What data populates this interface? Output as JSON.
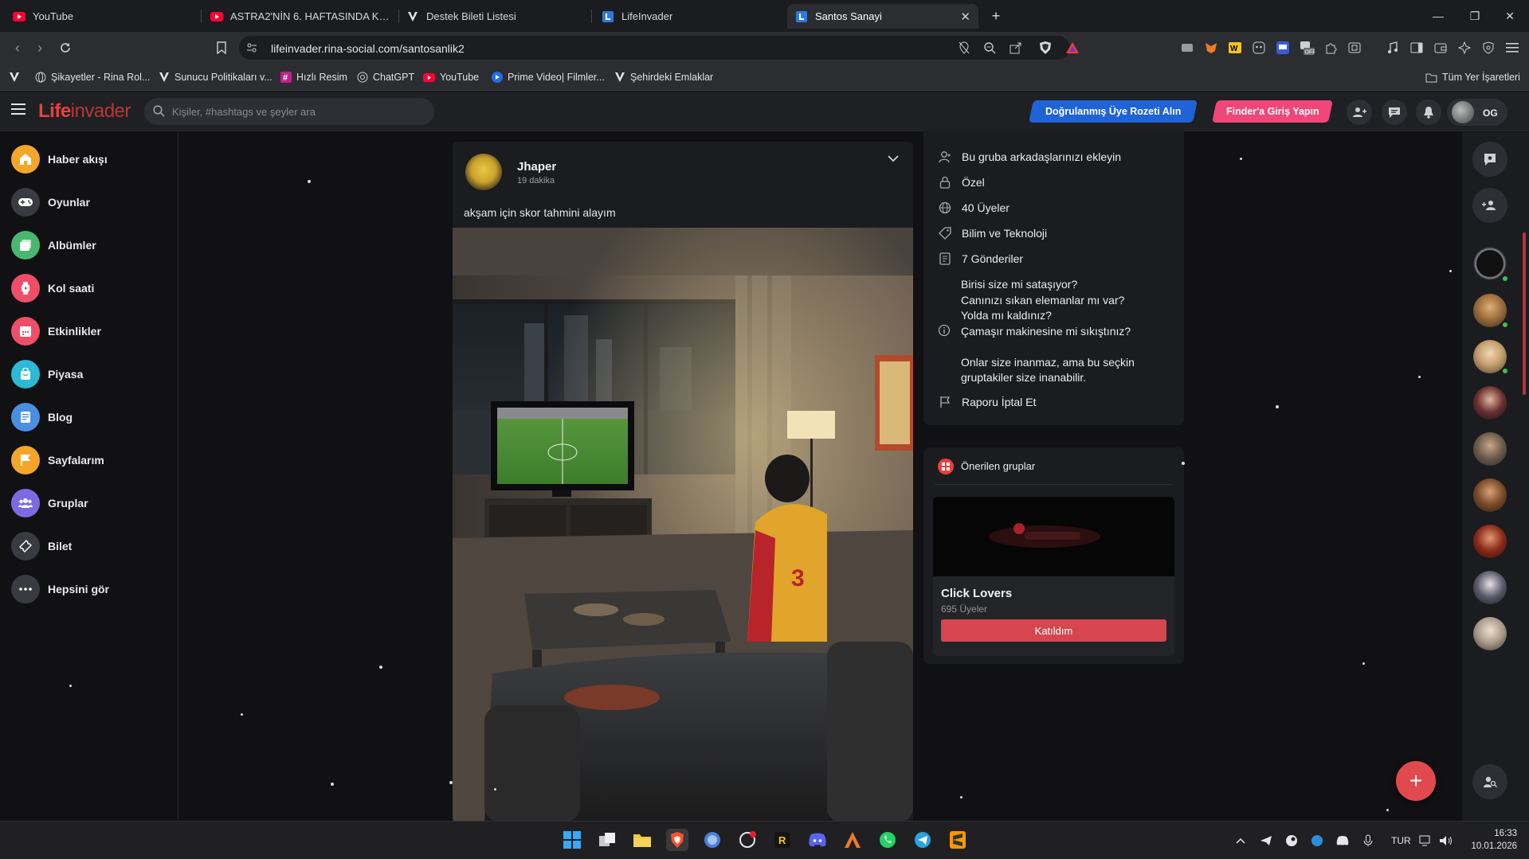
{
  "browser": {
    "tabs": [
      {
        "title": "YouTube",
        "icon": "youtube-icon"
      },
      {
        "title": "ASTRA2'NİN 6. HAFTASINDA KAZAN...",
        "icon": "youtube-icon"
      },
      {
        "title": "Destek Bileti Listesi",
        "icon": "v-logo-icon"
      },
      {
        "title": "LifeInvader",
        "icon": "lifeinvader-icon"
      },
      {
        "title": "Santos Sanayi",
        "icon": "lifeinvader-icon",
        "active": true
      }
    ],
    "url": "lifeinvader.rina-social.com/santosanlik2",
    "bookmarks": [
      {
        "label": "",
        "icon": "v-logo-icon"
      },
      {
        "label": "Şikayetler - Rina Rol...",
        "icon": "globe-icon"
      },
      {
        "label": "Sunucu Politikaları v...",
        "icon": "v-logo-icon"
      },
      {
        "label": "Hızlı Resim",
        "icon": "hashtag-icon"
      },
      {
        "label": "ChatGPT",
        "icon": "chatgpt-icon"
      },
      {
        "label": "YouTube",
        "icon": "youtube-icon"
      },
      {
        "label": "Prime Video| Filmler...",
        "icon": "prime-video-icon"
      },
      {
        "label": "Şehirdeki Emlaklar",
        "icon": "v-logo-icon"
      }
    ],
    "all_bookmarks_label": "Tüm Yer İşaretleri"
  },
  "app": {
    "logo_part1": "Life",
    "logo_part2": "invader",
    "search_placeholder": "Kişiler, #hashtags ve şeyler ara",
    "verified_badge_button": "Doğrulanmış Üye Rozeti Alın",
    "finder_login_button": "Finder'a Giriş Yapın",
    "user_initials": "OG",
    "colors": {
      "accent": "#e8413f",
      "verified_blue": "#1f63d6",
      "finder_pink": "#f0467a",
      "join_red": "#d5464f"
    }
  },
  "sidebar": {
    "items": [
      {
        "label": "Haber akışı",
        "icon": "home-icon",
        "color": "#f5a62a"
      },
      {
        "label": "Oyunlar",
        "icon": "gamepad-icon",
        "color": "#3a3b40"
      },
      {
        "label": "Albümler",
        "icon": "album-icon",
        "color": "#48b870"
      },
      {
        "label": "Kol saati",
        "icon": "watch-icon",
        "color": "#ef4e68"
      },
      {
        "label": "Etkinlikler",
        "icon": "calendar-icon",
        "color": "#ef4e68"
      },
      {
        "label": "Piyasa",
        "icon": "shopping-bag-icon",
        "color": "#2cb8d6"
      },
      {
        "label": "Blog",
        "icon": "blog-icon",
        "color": "#4a8fe0"
      },
      {
        "label": "Sayfalarım",
        "icon": "flag-icon",
        "color": "#f5a62a"
      },
      {
        "label": "Gruplar",
        "icon": "group-icon",
        "color": "#7d6ae0"
      },
      {
        "label": "Bilet",
        "icon": "ticket-icon",
        "color": "#3a3b40"
      },
      {
        "label": "Hepsini gör",
        "icon": "more-icon",
        "color": "#3a3b40"
      }
    ]
  },
  "post": {
    "author": "Jhaper",
    "time": "19 dakika",
    "text": "akşam için skor tahmini alayım"
  },
  "group_info": {
    "add_friends": "Bu gruba arkadaşlarınızı ekleyin",
    "privacy": "Özel",
    "members": "40 Üyeler",
    "category": "Bilim ve Teknoloji",
    "posts": "7 Gönderiler",
    "about_lines": [
      "Birisi size mi sataşıyor?",
      "Canınızı sıkan elemanlar mı var?",
      "Yolda mı kaldınız?",
      "Çamaşır makinesine mi sıkıştınız?",
      "",
      "Onlar size inanmaz, ama bu seçkin",
      "gruptakiler size inanabilir."
    ],
    "report": "Raporu İptal Et"
  },
  "suggested": {
    "title": "Önerilen gruplar",
    "group_name": "Click Lovers",
    "group_members": "695 Üyeler",
    "join_button": "Katıldım"
  },
  "taskbar": {
    "language": "TUR",
    "time": "16:33",
    "date": "10.01.2026"
  }
}
